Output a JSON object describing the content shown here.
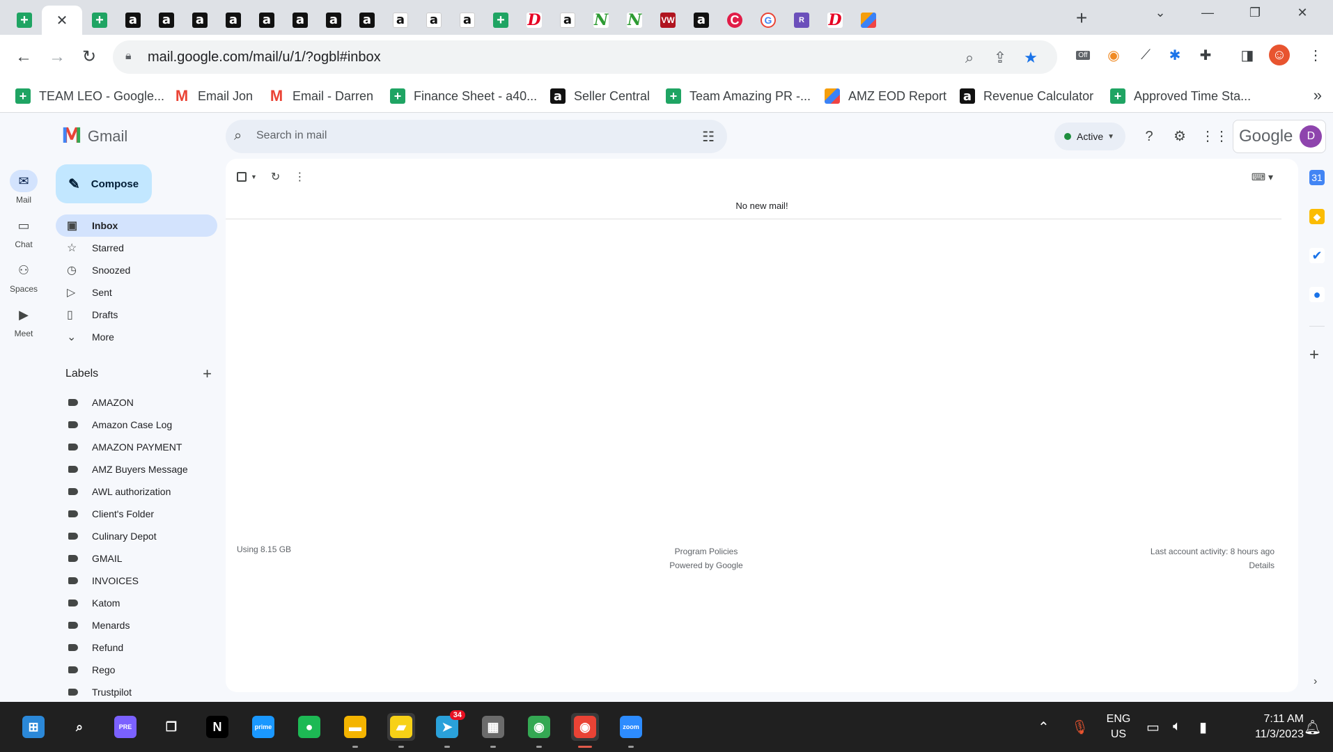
{
  "browser": {
    "tabs": [
      {
        "icon": "sheets-icon",
        "glyph": "+",
        "kind": "sheets"
      },
      {
        "icon": "close-icon",
        "glyph": "✕",
        "kind": "active"
      },
      {
        "icon": "sheets-icon",
        "glyph": "+",
        "kind": "sheets"
      },
      {
        "icon": "amazon-icon",
        "glyph": "a",
        "kind": "amazon"
      },
      {
        "icon": "amazon-icon",
        "glyph": "a",
        "kind": "amazon"
      },
      {
        "icon": "amazon-icon",
        "glyph": "a",
        "kind": "amazon"
      },
      {
        "icon": "amazon-icon",
        "glyph": "a",
        "kind": "amazon"
      },
      {
        "icon": "amazon-icon",
        "glyph": "a",
        "kind": "amazon"
      },
      {
        "icon": "amazon-icon",
        "glyph": "a",
        "kind": "amazon"
      },
      {
        "icon": "amazon-icon",
        "glyph": "a",
        "kind": "amazon"
      },
      {
        "icon": "amazon-icon",
        "glyph": "a",
        "kind": "amazon"
      },
      {
        "icon": "amazon-icon",
        "glyph": "a",
        "kind": "amazon-w"
      },
      {
        "icon": "amazon-icon",
        "glyph": "a",
        "kind": "amazon-w"
      },
      {
        "icon": "amazon-icon",
        "glyph": "a",
        "kind": "amazon-w"
      },
      {
        "icon": "sheets-icon",
        "glyph": "+",
        "kind": "sheets"
      },
      {
        "icon": "pinterest-icon",
        "glyph": "D",
        "kind": "pin"
      },
      {
        "icon": "amazon-icon",
        "glyph": "a",
        "kind": "amazon-w"
      },
      {
        "icon": "n-icon",
        "glyph": "N",
        "kind": "green-n"
      },
      {
        "icon": "n-icon",
        "glyph": "N",
        "kind": "green-n"
      },
      {
        "icon": "ww-icon",
        "glyph": "VW",
        "kind": "ww"
      },
      {
        "icon": "amazon-icon",
        "glyph": "a",
        "kind": "amazon"
      },
      {
        "icon": "c-icon",
        "glyph": "C",
        "kind": "red-c"
      },
      {
        "icon": "google-icon",
        "glyph": "G",
        "kind": "google"
      },
      {
        "icon": "rb-icon",
        "glyph": "R",
        "kind": "purple"
      },
      {
        "icon": "pinterest-icon",
        "glyph": "D",
        "kind": "pin"
      },
      {
        "icon": "stripe-icon",
        "glyph": "",
        "kind": "stripe"
      }
    ],
    "new_tab": "+",
    "url": "mail.google.com/mail/u/1/?ogbl#inbox",
    "bookmarks": [
      {
        "label": "TEAM LEO - Google...",
        "icon": "sheets-icon",
        "kind": "sheets",
        "glyph": "+"
      },
      {
        "label": "Email Jon",
        "icon": "gmail-icon",
        "kind": "gmail",
        "glyph": "M"
      },
      {
        "label": "Email - Darren",
        "icon": "gmail-icon",
        "kind": "gmail",
        "glyph": "M"
      },
      {
        "label": "Finance Sheet - a40...",
        "icon": "sheets-icon",
        "kind": "sheets",
        "glyph": "+"
      },
      {
        "label": "Seller Central",
        "icon": "amazon-icon",
        "kind": "amazon",
        "glyph": "a"
      },
      {
        "label": "Team Amazing PR -...",
        "icon": "sheets-icon",
        "kind": "sheets",
        "glyph": "+"
      },
      {
        "label": "AMZ EOD Report",
        "icon": "stripe-icon",
        "kind": "stripe",
        "glyph": ""
      },
      {
        "label": "Revenue Calculator",
        "icon": "amazon-icon",
        "kind": "amazon",
        "glyph": "a"
      },
      {
        "label": "Approved Time Sta...",
        "icon": "sheets-icon",
        "kind": "sheets",
        "glyph": "+"
      }
    ],
    "bookmarks_more": "»",
    "ext_badge": "Off"
  },
  "gmail": {
    "product_name": "Gmail",
    "rail": [
      {
        "label": "Mail",
        "icon": "mail-icon",
        "glyph": "✉"
      },
      {
        "label": "Chat",
        "icon": "chat-icon",
        "glyph": "▭"
      },
      {
        "label": "Spaces",
        "icon": "spaces-icon",
        "glyph": "⚇"
      },
      {
        "label": "Meet",
        "icon": "meet-icon",
        "glyph": "▶"
      }
    ],
    "compose_label": "Compose",
    "nav": [
      {
        "label": "Inbox",
        "icon": "inbox-icon",
        "glyph": "▣"
      },
      {
        "label": "Starred",
        "icon": "star-icon",
        "glyph": "☆"
      },
      {
        "label": "Snoozed",
        "icon": "clock-icon",
        "glyph": "◷"
      },
      {
        "label": "Sent",
        "icon": "send-icon",
        "glyph": "▷"
      },
      {
        "label": "Drafts",
        "icon": "draft-icon",
        "glyph": "▯"
      },
      {
        "label": "More",
        "icon": "chevron-down-icon",
        "glyph": "⌄"
      }
    ],
    "labels_heading": "Labels",
    "labels": [
      "AMAZON",
      "Amazon Case Log",
      "AMAZON PAYMENT",
      "AMZ Buyers Message",
      "AWL authorization",
      "Client's Folder",
      "Culinary Depot",
      "GMAIL",
      "INVOICES",
      "Katom",
      "Menards",
      "Refund",
      "Rego",
      "Trustpilot"
    ],
    "search_placeholder": "Search in mail",
    "status": "Active",
    "google_wordmark": "Google",
    "avatar_initial": "D",
    "empty_message": "No new mail!",
    "storage": "Using 8.15 GB",
    "policies": "Program Policies",
    "powered_by": "Powered by Google",
    "last_activity": "Last account activity: 8 hours ago",
    "details": "Details"
  },
  "taskbar": {
    "apps": [
      {
        "name": "start-button",
        "glyph": "⊞",
        "bg": "#2b88d8"
      },
      {
        "name": "search-icon",
        "glyph": "⌕",
        "bg": "transparent"
      },
      {
        "name": "copilot-icon",
        "glyph": "PRE",
        "bg": "#7b61ff"
      },
      {
        "name": "task-view-icon",
        "glyph": "❐",
        "bg": "transparent"
      },
      {
        "name": "netflix-icon",
        "glyph": "N",
        "bg": "#000000"
      },
      {
        "name": "prime-video-icon",
        "glyph": "prime",
        "bg": "#1a98ff"
      },
      {
        "name": "spotify-icon",
        "glyph": "●",
        "bg": "#1db954"
      },
      {
        "name": "file-explorer-icon",
        "glyph": "▬",
        "bg": "#f4b400"
      },
      {
        "name": "sticky-notes-icon",
        "glyph": "▰",
        "bg": "#f7d117"
      },
      {
        "name": "telegram-icon",
        "glyph": "➤",
        "bg": "#2aa1da"
      },
      {
        "name": "calculator-icon",
        "glyph": "▦",
        "bg": "#6b6b6b"
      },
      {
        "name": "chrome-icon",
        "glyph": "◉",
        "bg": "#34a853"
      },
      {
        "name": "chrome-icon",
        "glyph": "◉",
        "bg": "#ea4335"
      },
      {
        "name": "zoom-icon",
        "glyph": "zoom",
        "bg": "#2d8cff"
      }
    ],
    "telegram_badge": "34",
    "language_line1": "ENG",
    "language_line2": "US",
    "time": "7:11 AM",
    "date": "11/3/2023"
  },
  "colors": {
    "accent": "#0b57d0",
    "selected_nav": "#d3e3fd",
    "compose": "#c2e7ff",
    "status_green": "#1e8e3e"
  }
}
